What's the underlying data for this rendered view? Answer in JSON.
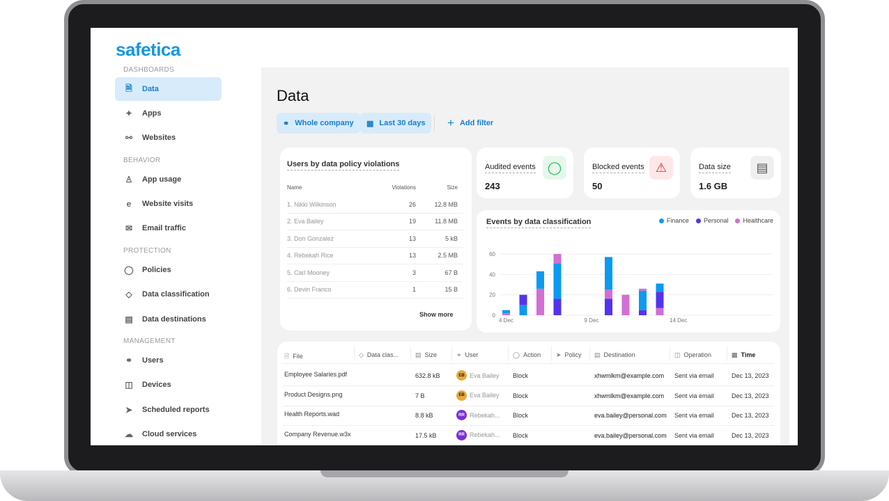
{
  "app": {
    "logo": "safetica"
  },
  "sidebar": {
    "sections": [
      {
        "label": "DASHBOARDS",
        "items": [
          {
            "label": "Data",
            "icon": "document-icon",
            "active": true
          },
          {
            "label": "Apps",
            "icon": "apps-icon"
          },
          {
            "label": "Websites",
            "icon": "globe-icon"
          }
        ]
      },
      {
        "label": "BEHAVIOR",
        "items": [
          {
            "label": "App usage",
            "icon": "chess-icon"
          },
          {
            "label": "Website visits",
            "icon": "browser-icon"
          },
          {
            "label": "Email traffic",
            "icon": "mail-icon"
          }
        ]
      },
      {
        "label": "PROTECTION",
        "items": [
          {
            "label": "Policies",
            "icon": "shield-icon"
          },
          {
            "label": "Data classification",
            "icon": "tag-icon"
          },
          {
            "label": "Data destinations",
            "icon": "briefcase-icon"
          }
        ]
      },
      {
        "label": "MANAGEMENT",
        "items": [
          {
            "label": "Users",
            "icon": "users-icon"
          },
          {
            "label": "Devices",
            "icon": "devices-icon"
          },
          {
            "label": "Scheduled reports",
            "icon": "send-icon"
          },
          {
            "label": "Cloud services",
            "icon": "cloud-icon"
          }
        ]
      }
    ]
  },
  "main": {
    "title": "Data",
    "filters": {
      "scope": "Whole company",
      "period": "Last 30 days",
      "add": "Add filter"
    },
    "users_card": {
      "title": "Users by data policy violations",
      "headers": [
        "Name",
        "Violations",
        "Size"
      ],
      "rows": [
        [
          "1. Nikki Wilkinson",
          "26",
          "12.8 MB"
        ],
        [
          "2. Eva Bailey",
          "19",
          "11.8 MB"
        ],
        [
          "3. Don Gonzalez",
          "13",
          "5 kB"
        ],
        [
          "4. Rebekah Rice",
          "13",
          "2.5 MB"
        ],
        [
          "5. Carl Mooney",
          "3",
          "67 B"
        ],
        [
          "6. Devin Franco",
          "1",
          "15 B"
        ]
      ],
      "show_more": "Show more"
    },
    "stats": [
      {
        "label": "Audited events",
        "value": "243",
        "icon": "shield-icon",
        "color": "#22b455"
      },
      {
        "label": "Blocked events",
        "value": "50",
        "icon": "warning-icon",
        "color": "#e5252a"
      },
      {
        "label": "Data size",
        "value": "1.6 GB",
        "icon": "storage-icon",
        "color": "#555555"
      }
    ],
    "table": {
      "headers": [
        "File",
        "Data clas...",
        "Size",
        "User",
        "Action",
        "Policy",
        "Destination",
        "Operation",
        "Time"
      ],
      "rows": [
        {
          "file": "Employee Salaries.pdf",
          "size": "632.8 kB",
          "initials": "EB",
          "user": "Eva Bailey",
          "avatar": "#e8a83a",
          "action": "Block",
          "dest": "xhwmlkm@example.com",
          "op": "Sent via email",
          "time": "Dec 13, 2023"
        },
        {
          "file": "Product Designs.png",
          "size": "7 B",
          "initials": "EB",
          "user": "Eva Bailey",
          "avatar": "#e8a83a",
          "action": "Block",
          "dest": "xhwmlkm@example.com",
          "op": "Sent via email",
          "time": "Dec 13, 2023"
        },
        {
          "file": "Health Reports.wad",
          "size": "8.8 kB",
          "initials": "RR",
          "user": "Rebekah...",
          "avatar": "#7a2fd8",
          "action": "Block",
          "dest": "eva.bailey@personal.com",
          "op": "Sent via email",
          "time": "Dec 13, 2023"
        },
        {
          "file": "Company Revenue.w3x",
          "size": "17.5 kB",
          "initials": "RR",
          "user": "Rebekah...",
          "avatar": "#7a2fd8",
          "action": "Block",
          "dest": "eva.bailey@personal.com",
          "op": "Sent via email",
          "time": "Dec 13, 2023"
        }
      ]
    }
  },
  "chart_data": {
    "type": "bar",
    "stacked": true,
    "title": "Events by data classification",
    "legend_position": "top-right",
    "series": [
      {
        "name": "Finance",
        "color": "#0a9af0"
      },
      {
        "name": "Personal",
        "color": "#5433ee"
      },
      {
        "name": "Healthcare",
        "color": "#d16fd3"
      }
    ],
    "x_ticks": [
      "4 Dec",
      "9 Dec",
      "14 Dec"
    ],
    "y_ticks": [
      0,
      20,
      40,
      60
    ],
    "ylim": [
      0,
      60
    ],
    "grid": true,
    "bars": [
      {
        "date": "4 Dec",
        "segments": [
          [
            "Healthcare",
            2
          ],
          [
            "Finance",
            3
          ]
        ]
      },
      {
        "date": "5 Dec",
        "segments": [
          [
            "Finance",
            10
          ],
          [
            "Personal",
            10
          ]
        ]
      },
      {
        "date": "6 Dec",
        "segments": [
          [
            "Healthcare",
            26
          ],
          [
            "Finance",
            17
          ]
        ]
      },
      {
        "date": "7 Dec",
        "segments": [
          [
            "Personal",
            16
          ],
          [
            "Finance",
            35
          ],
          [
            "Healthcare",
            9
          ]
        ]
      },
      {
        "date": "10 Dec",
        "segments": [
          [
            "Personal",
            16
          ],
          [
            "Healthcare",
            9
          ],
          [
            "Finance",
            32
          ]
        ]
      },
      {
        "date": "11 Dec",
        "segments": [
          [
            "Healthcare",
            20
          ]
        ]
      },
      {
        "date": "12 Dec",
        "segments": [
          [
            "Personal",
            5
          ],
          [
            "Finance",
            19
          ],
          [
            "Healthcare",
            2
          ]
        ]
      },
      {
        "date": "13 Dec",
        "segments": [
          [
            "Healthcare",
            7
          ],
          [
            "Personal",
            16
          ],
          [
            "Finance",
            8
          ]
        ]
      }
    ]
  }
}
